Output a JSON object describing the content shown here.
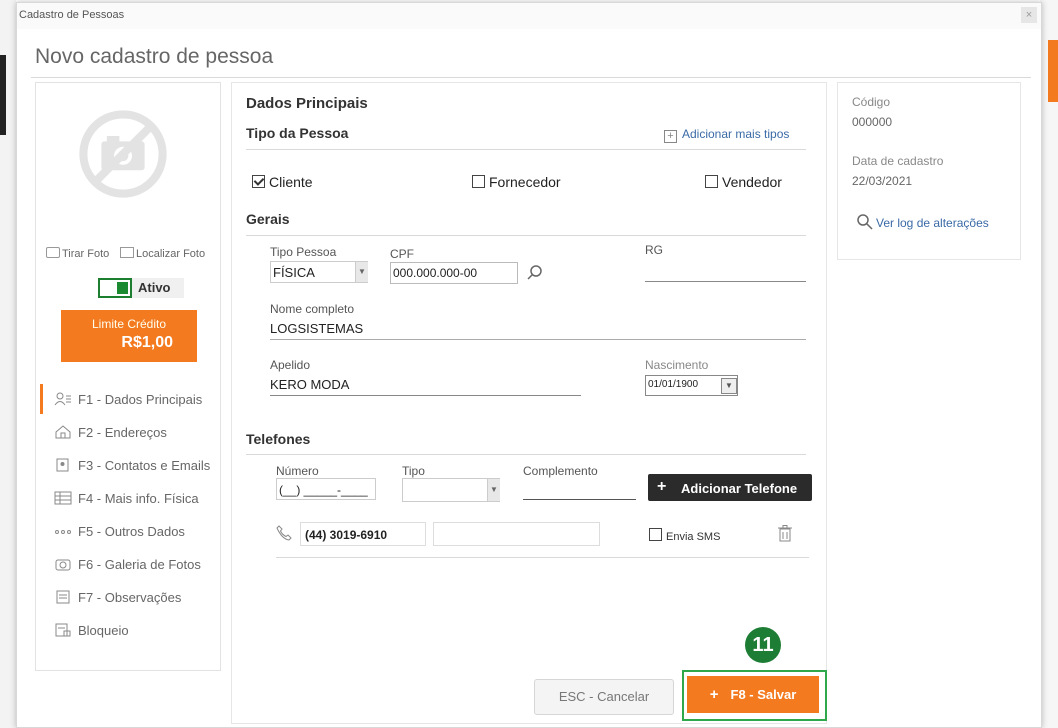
{
  "window": {
    "title": "Cadastro de Pessoas",
    "close": "×",
    "heading": "Novo cadastro de pessoa"
  },
  "left": {
    "take_photo": "Tirar Foto",
    "find_photo": "Localizar Foto",
    "status_label": "Ativo",
    "credit_label": "Limite Crédito",
    "credit_value": "R$1,00",
    "nav": [
      {
        "label": "F1 - Dados Principais",
        "icon": "user-card-icon"
      },
      {
        "label": "F2 - Endereços",
        "icon": "house-icon"
      },
      {
        "label": "F3 - Contatos e Emails",
        "icon": "contact-icon"
      },
      {
        "label": "F4 - Mais info. Física",
        "icon": "table-icon"
      },
      {
        "label": "F5 - Outros Dados",
        "icon": "dots-icon"
      },
      {
        "label": "F6 - Galeria de Fotos",
        "icon": "camera-icon"
      },
      {
        "label": "F7 - Observações",
        "icon": "note-icon"
      },
      {
        "label": "Bloqueio",
        "icon": "lock-doc-icon"
      }
    ]
  },
  "main": {
    "section_title": "Dados Principais",
    "tipo_title": "Tipo da Pessoa",
    "add_types": "Adicionar mais tipos",
    "types": [
      {
        "label": "Cliente",
        "checked": true
      },
      {
        "label": "Fornecedor",
        "checked": false
      },
      {
        "label": "Vendedor",
        "checked": false
      }
    ],
    "gerais_title": "Gerais",
    "tipo_pessoa_label": "Tipo Pessoa",
    "tipo_pessoa_value": "FÍSICA",
    "cpf_label": "CPF",
    "cpf_value": "000.000.000-00",
    "rg_label": "RG",
    "nome_label": "Nome completo",
    "nome_value": "LOGSISTEMAS",
    "apelido_label": "Apelido",
    "apelido_value": "KERO MODA",
    "nascimento_label": "Nascimento",
    "nascimento_value": "01/01/1900",
    "telefones_title": "Telefones",
    "numero_label": "Número",
    "numero_mask": "(__) _____-____",
    "tipo_label": "Tipo",
    "complemento_label": "Complemento",
    "add_phone": "Adicionar Telefone",
    "phone_value": "(44) 3019-6910",
    "sms_label": "Envia SMS",
    "cancel": "ESC - Cancelar",
    "save": "F8 - Salvar",
    "step_badge": "11"
  },
  "right": {
    "code_label": "Código",
    "code_value": "000000",
    "date_label": "Data de cadastro",
    "date_value": "22/03/2021",
    "log_link": "Ver log de alterações"
  },
  "colors": {
    "accent": "#f47a20",
    "highlight": "#2ea84a",
    "badge": "#1e7d34"
  }
}
